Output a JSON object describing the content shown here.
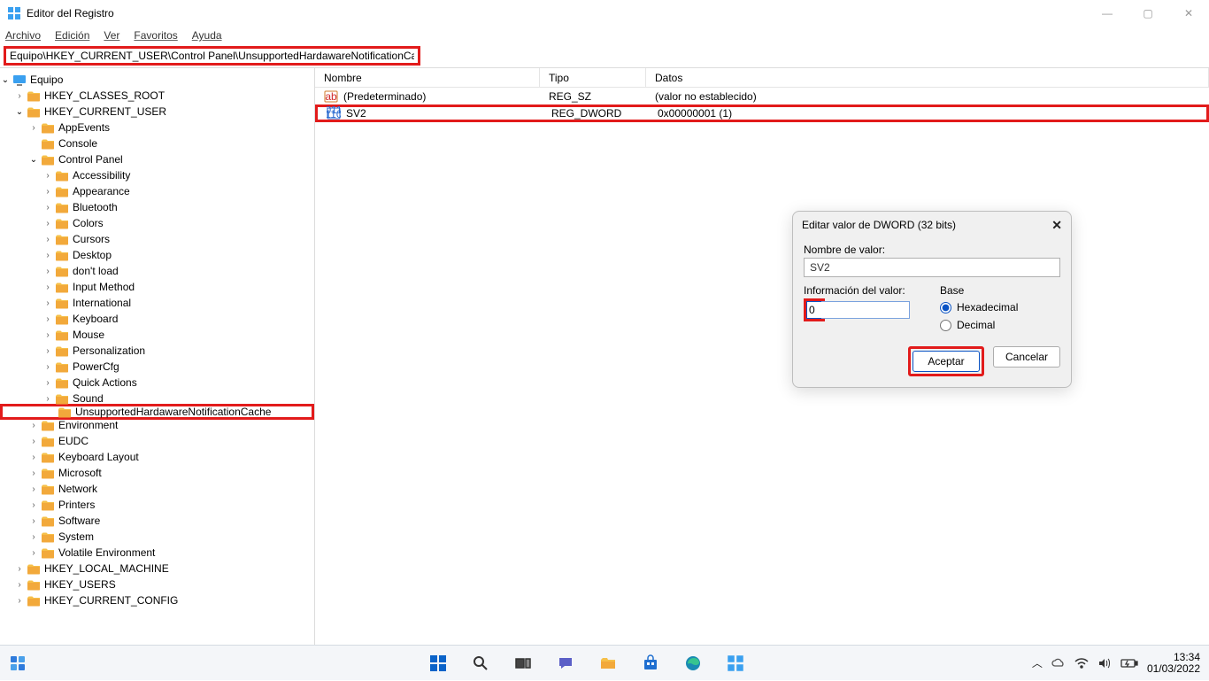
{
  "window": {
    "title": "Editor del Registro",
    "controls": {
      "min": "—",
      "max": "▢",
      "close": "✕"
    }
  },
  "menu": {
    "file": "Archivo",
    "edit": "Edición",
    "view": "Ver",
    "fav": "Favoritos",
    "help": "Ayuda"
  },
  "address": "Equipo\\HKEY_CURRENT_USER\\Control Panel\\UnsupportedHardawareNotificationCache",
  "tree": {
    "root": "Equipo",
    "hkcr": "HKEY_CLASSES_ROOT",
    "hkcu": "HKEY_CURRENT_USER",
    "appevents": "AppEvents",
    "console": "Console",
    "controlpanel": "Control Panel",
    "cp_items": [
      "Accessibility",
      "Appearance",
      "Bluetooth",
      "Colors",
      "Cursors",
      "Desktop",
      "don't load",
      "Input Method",
      "International",
      "Keyboard",
      "Mouse",
      "Personalization",
      "PowerCfg",
      "Quick Actions",
      "Sound"
    ],
    "unsupported": "UnsupportedHardawareNotificationCache",
    "environment": "Environment",
    "eudc": "EUDC",
    "keyboardlayout": "Keyboard Layout",
    "microsoft": "Microsoft",
    "network": "Network",
    "printers": "Printers",
    "software": "Software",
    "system": "System",
    "volatile": "Volatile Environment",
    "hklm": "HKEY_LOCAL_MACHINE",
    "hku": "HKEY_USERS",
    "hkcc": "HKEY_CURRENT_CONFIG"
  },
  "list": {
    "headers": {
      "name": "Nombre",
      "type": "Tipo",
      "data": "Datos"
    },
    "rows": [
      {
        "icon": "sz",
        "name": "(Predeterminado)",
        "type": "REG_SZ",
        "data": "(valor no establecido)"
      },
      {
        "icon": "dw",
        "name": "SV2",
        "type": "REG_DWORD",
        "data": "0x00000001 (1)"
      }
    ]
  },
  "dialog": {
    "title": "Editar valor de DWORD (32 bits)",
    "name_label": "Nombre de valor:",
    "name_value": "SV2",
    "value_label": "Información del valor:",
    "value_data": "0",
    "base_label": "Base",
    "hex": "Hexadecimal",
    "dec": "Decimal",
    "ok": "Aceptar",
    "cancel": "Cancelar"
  },
  "taskbar": {
    "time": "13:34",
    "date": "01/03/2022"
  }
}
